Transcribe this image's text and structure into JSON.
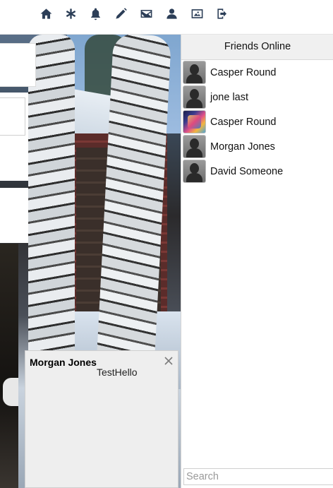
{
  "nav": {
    "icons": [
      "home-icon",
      "asterisk-icon",
      "bell-icon",
      "pencil-icon",
      "mail-icon",
      "user-icon",
      "picture-icon",
      "logout-icon"
    ],
    "icon_color": "#2c3e57"
  },
  "friends_panel": {
    "title": "Friends Online",
    "friends": [
      {
        "name": "Casper Round",
        "avatar": "default-avatar-icon"
      },
      {
        "name": "jone last",
        "avatar": "default-avatar-icon"
      },
      {
        "name": "Casper Round",
        "avatar": "photo-avatar"
      },
      {
        "name": "Morgan Jones",
        "avatar": "default-avatar-icon"
      },
      {
        "name": "David Someone",
        "avatar": "default-avatar-icon"
      }
    ],
    "search_placeholder": "Search"
  },
  "chat": {
    "title": "Morgan Jones",
    "message": "TestHello",
    "close_icon": "close-icon"
  }
}
